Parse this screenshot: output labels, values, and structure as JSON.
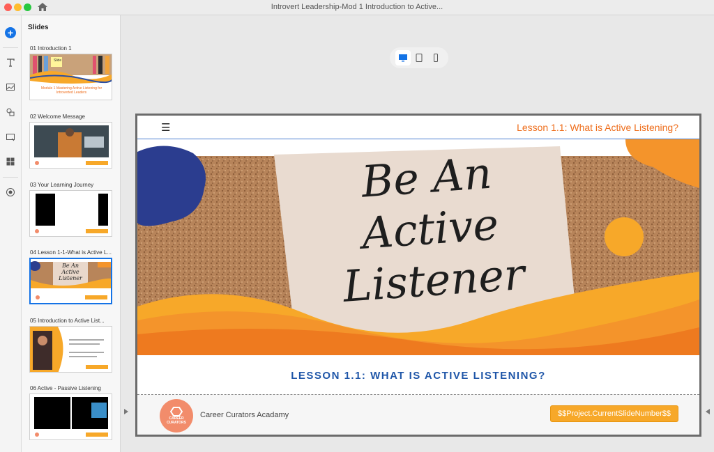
{
  "window": {
    "title": "Introvert Leadership-Mod 1 Introduction to Active..."
  },
  "slides_panel": {
    "heading": "Slides",
    "items": [
      {
        "label": "01  Introduction 1",
        "caption": "Module 1 Mastering Active Listening for Introverted Leaders",
        "badge": "Slide"
      },
      {
        "label": "02  Welcome Message"
      },
      {
        "label": "03  Your Learning Journey"
      },
      {
        "label": "04  Lesson 1-1-What is Active L...",
        "thumb_text": "Be An Active Listener",
        "selected": true
      },
      {
        "label": "05  Introduction to Active List..."
      },
      {
        "label": "06  Active - Passive Listening"
      }
    ]
  },
  "device_modes": [
    {
      "name": "desktop",
      "active": true
    },
    {
      "name": "tablet",
      "active": false
    },
    {
      "name": "mobile",
      "active": false
    }
  ],
  "slide": {
    "menu_icon": "☰",
    "header_title": "Lesson 1.1: What is Active Listening?",
    "hero_text": [
      "Be An",
      "Active",
      "Listener"
    ],
    "lesson_title": "LESSON 1.1: WHAT IS ACTIVE LISTENING?",
    "logo_lines": [
      "CAREER",
      "CURATORS"
    ],
    "academy_name": "Career Curators Acadamy",
    "slide_number_var": "$$Project.CurrentSlideNumber$$"
  },
  "colors": {
    "accent_blue": "#1473e6",
    "header_orange": "#ee6d1b",
    "lesson_blue": "#1f56a8",
    "badge_orange": "#f7a829"
  }
}
